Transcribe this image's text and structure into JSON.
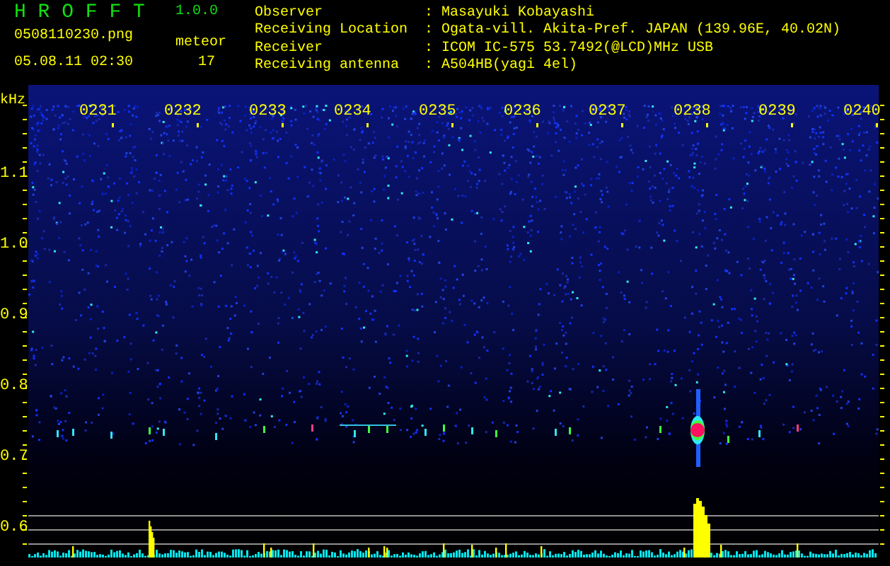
{
  "app": {
    "name": "H R O F F T",
    "version": "1.0.0"
  },
  "file": {
    "name": "0508110230.png",
    "datetime": "05.08.11 02:30"
  },
  "meteor": {
    "label": "meteor",
    "count": "17"
  },
  "info": [
    {
      "label": "Observer",
      "value": ": Masayuki Kobayashi"
    },
    {
      "label": "Receiving Location",
      "value": ": Ogata-vill. Akita-Pref. JAPAN (139.96E, 40.02N)"
    },
    {
      "label": "Receiver",
      "value": ": ICOM IC-575 53.7492(@LCD)MHz USB"
    },
    {
      "label": "Receiving antenna",
      "value": ": A504HB(yagi 4el)"
    }
  ],
  "spectrogram": {
    "unit": "kHz",
    "y_labels": [
      "1.1",
      "1.0",
      "0.9",
      "0.8",
      "0.7",
      "0.6"
    ],
    "time_labels": [
      "0231",
      "0232",
      "0233",
      "0234",
      "0235",
      "0236",
      "0237",
      "0238",
      "0239",
      "0240"
    ]
  }
}
